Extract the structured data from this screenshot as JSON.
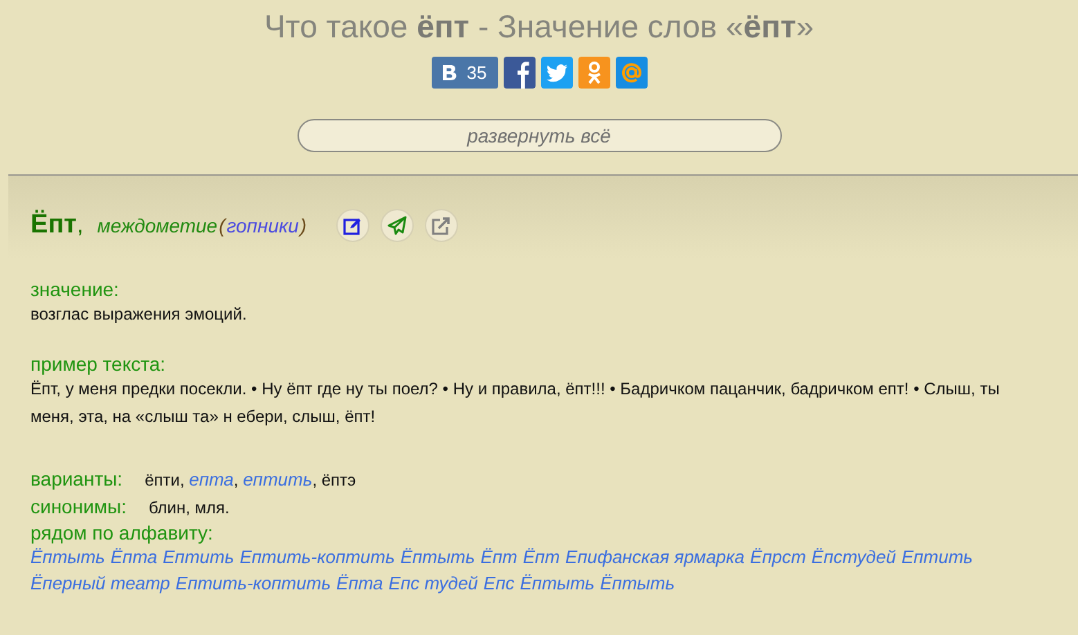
{
  "title": "Что такое **ёпт** - Значение слов «**ёпт**»",
  "share": {
    "vk_count": "35"
  },
  "expand_button": "развернуть всё",
  "entry": {
    "headword": "Ёпт",
    "comma": ",",
    "part_of_speech": "междометие",
    "open_paren": "(",
    "domain": "гопники",
    "close_paren": ")",
    "meaning": {
      "label": "значение:",
      "text": "возглас выражения эмоций."
    },
    "example": {
      "label": "пример текста:",
      "text": "Ёпт, у меня предки посекли. • Ну ёпт где ну ты поел? • Ну и правила, ёпт!!! • Бадричком пацанчик, бадричком епт! • Слыш, ты меня, эта, на «слыш та» н ебери, слыш, ёпт!"
    },
    "variants": {
      "label": "варианты:",
      "separator": ", ",
      "items": [
        {
          "text": "ёпти",
          "link": false
        },
        {
          "text": "епта",
          "link": true
        },
        {
          "text": "ептить",
          "link": true
        },
        {
          "text": "ёптэ",
          "link": false
        }
      ]
    },
    "synonyms": {
      "label": "синонимы:",
      "text": "блин, мля."
    },
    "nearby": {
      "label": "рядом по алфавиту:",
      "items": [
        "Ёптыть",
        "Ёпта",
        "Ептить",
        "Ептить-коптить",
        "Ёптыть",
        "Ёпт",
        "Ёпт",
        "Епифанская ярмарка",
        "Ёпрст",
        "Ёпстудей",
        "Ептить",
        "Ёперный театр",
        "Ептить-коптить",
        "Ёпта",
        "Епс тудей",
        "Епс",
        "Ёптыть",
        "Ёптыть"
      ]
    }
  }
}
